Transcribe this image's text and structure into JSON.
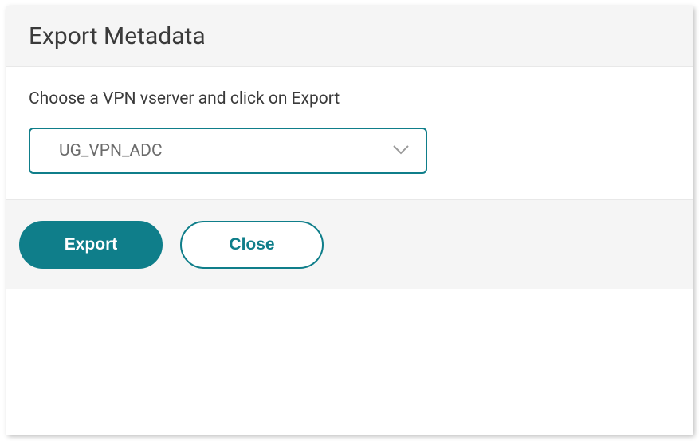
{
  "dialog": {
    "title": "Export Metadata",
    "instruction": "Choose a VPN vserver and click on Export",
    "select": {
      "selected_value": "UG_VPN_ADC"
    },
    "buttons": {
      "export_label": "Export",
      "close_label": "Close"
    }
  }
}
